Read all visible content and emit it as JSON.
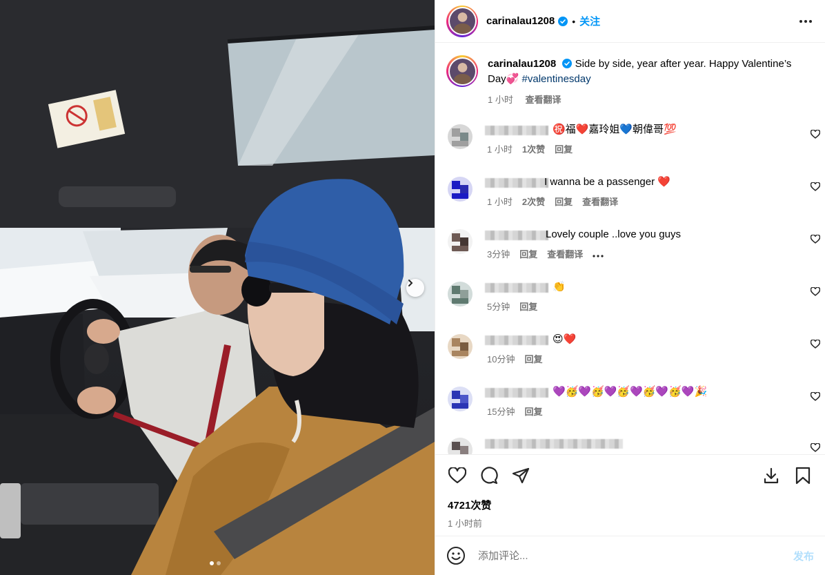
{
  "post": {
    "username": "carinalau1208",
    "follow_label": "关注",
    "separator": "•",
    "caption_text": "Side by side, year after year. Happy Valentine’s Day💞",
    "hashtag": "#valentinesday",
    "caption_time": "1 小时",
    "caption_translate": "查看翻译"
  },
  "comments": [
    {
      "text": "㊗️福❤️嘉玲姐💙朝偉哥💯",
      "time": "1 小时",
      "likes": "1次赞",
      "reply": "回复",
      "translate": "",
      "avatar_colors": [
        "#9f9f9f",
        "#d7d7d7",
        "#7a8a8a"
      ]
    },
    {
      "text": "I wanna be a passenger ❤️",
      "time": "1 小时",
      "likes": "2次赞",
      "reply": "回复",
      "translate": "查看翻译",
      "avatar_colors": [
        "#1b1bc4",
        "#d6d6f4",
        "#2a2ab0"
      ]
    },
    {
      "text": "Lovely couple ..love you guys",
      "time": "3分钟",
      "likes": "",
      "reply": "回复",
      "translate": "查看翻译",
      "avatar_colors": [
        "#6e5a54",
        "#f2f2f2",
        "#453733"
      ]
    },
    {
      "text": "👏",
      "time": "5分钟",
      "likes": "",
      "reply": "回复",
      "translate": "",
      "avatar_colors": [
        "#5f7a70",
        "#d2dcda",
        "#8f9f99"
      ]
    },
    {
      "text": "😍❤️",
      "time": "10分钟",
      "likes": "",
      "reply": "回复",
      "translate": "",
      "avatar_colors": [
        "#a98560",
        "#e8d8c4",
        "#7a5c40"
      ]
    },
    {
      "text": "💜🥳💜🥳💜🥳💜🥳💜🥳💜🎉",
      "time": "15分钟",
      "likes": "",
      "reply": "回复",
      "translate": "",
      "avatar_colors": [
        "#2b35b4",
        "#dcdff5",
        "#4d57c9"
      ]
    },
    {
      "text": "",
      "time": "",
      "likes": "",
      "reply": "",
      "translate": "",
      "avatar_colors": [
        "#5a5050",
        "#e5e5e5",
        "#8a7f7f"
      ]
    }
  ],
  "footer": {
    "likes_count": "4721次赞",
    "posted_ago": "1 小时前",
    "comment_placeholder": "添加评论...",
    "post_label": "发布"
  },
  "colors": {
    "accent": "#0095f6",
    "secondary_text": "#737373",
    "like_red": "#ed4956"
  },
  "carousel": {
    "total_slides": 2,
    "current_slide": 1
  }
}
